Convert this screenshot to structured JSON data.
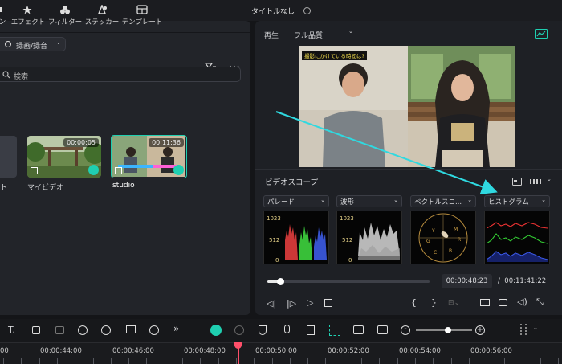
{
  "window": {
    "title": "タイトルなし"
  },
  "media_toolbar": {
    "items": [
      {
        "label": "ン",
        "icon": "audio-icon"
      },
      {
        "label": "エフェクト",
        "icon": "effect-icon"
      },
      {
        "label": "フィルター",
        "icon": "filter-icon"
      },
      {
        "label": "ステッカー",
        "icon": "sticker-icon"
      },
      {
        "label": "テンプレート",
        "icon": "template-icon"
      }
    ]
  },
  "media_panel": {
    "record_dropdown": "録画/録音",
    "search_placeholder": "検索",
    "clips": [
      {
        "name": "ト",
        "duration": ""
      },
      {
        "name": "マイビデオ",
        "duration": "00:00:05"
      },
      {
        "name": "studio",
        "duration": "00:11:36"
      }
    ]
  },
  "preview": {
    "play_label": "再生",
    "quality": "フル品質",
    "video_caption": "撮影にかけている時間は?"
  },
  "videoscope": {
    "title": "ビデオスコープ",
    "scopes": [
      {
        "label": "パレード",
        "scale": [
          "1023",
          "512",
          "0"
        ]
      },
      {
        "label": "波形",
        "scale": [
          "1023",
          "512",
          "0"
        ]
      },
      {
        "label": "ベクトルスコ...",
        "scale": []
      },
      {
        "label": "ヒストグラム",
        "scale": []
      }
    ]
  },
  "playback": {
    "progress": 0.08,
    "current_time": "00:00:48:23",
    "separator": "/",
    "total_time": "00:11:41:22",
    "mark_in": "{",
    "mark_out": "}"
  },
  "timeline": {
    "ticks": [
      "00",
      "00:00:44:00",
      "00:00:46:00",
      "00:00:48:00",
      "00:00:50:00",
      "00:00:52:00",
      "00:00:54:00",
      "00:00:56:00"
    ],
    "playhead_time": "00:00:48:23"
  },
  "colors": {
    "accent": "#1fcfb1",
    "playhead": "#ff4f6a",
    "annotation_arrow": "#2fd9e0"
  }
}
